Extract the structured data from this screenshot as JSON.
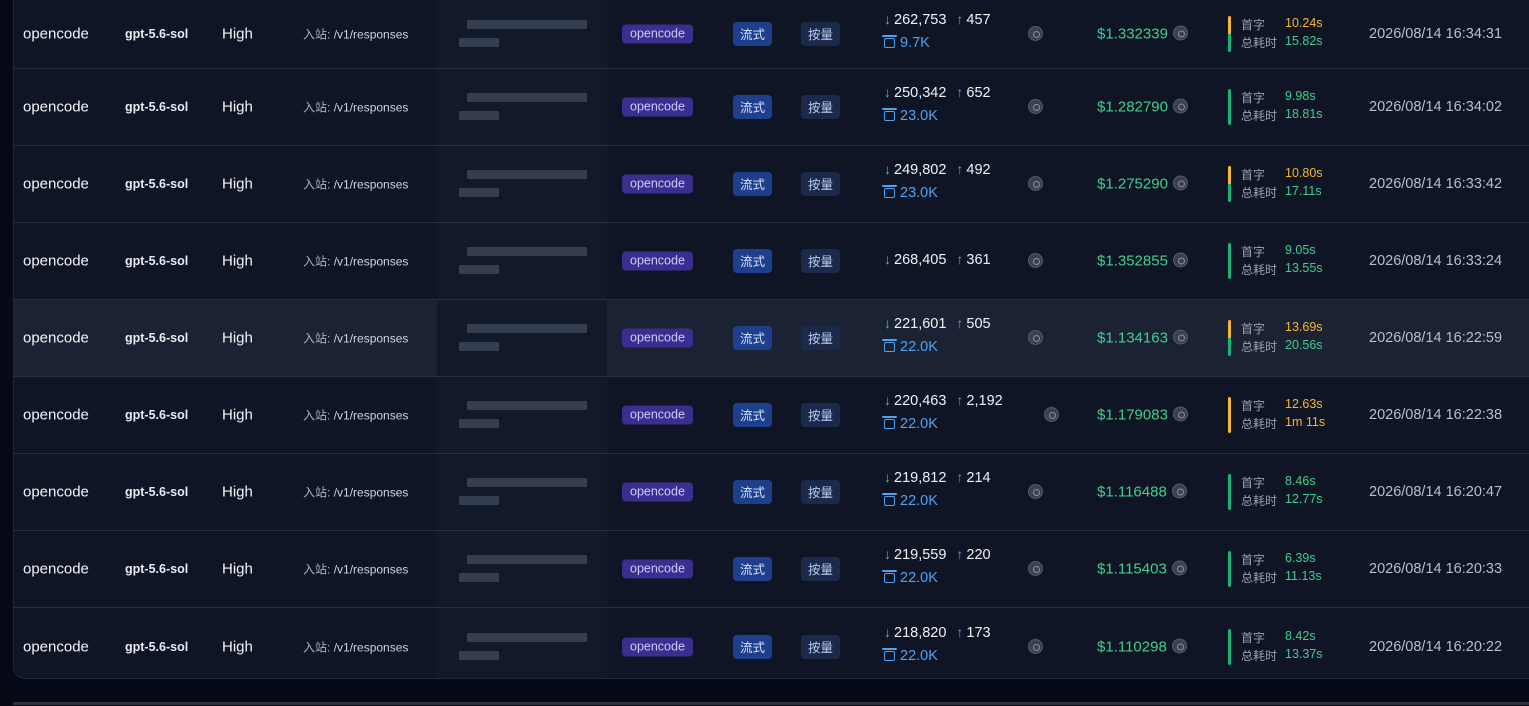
{
  "labels": {
    "endpoint_prefix": "入站:",
    "first_token": "首字",
    "total_time": "总耗时"
  },
  "colors": {
    "cost": "#3fcf8e",
    "timing_fast": "#3fcf8e",
    "timing_slow": "#f5b731",
    "bar_green": "#19b37a",
    "bar_yellow": "#f5b731"
  },
  "rows": [
    {
      "client": "opencode",
      "model": "gpt-5.6-sol",
      "effort": "High",
      "endpoint": "/v1/responses",
      "agent": "opencode",
      "mode": "流式",
      "billing": "按量",
      "input": "262,753",
      "output": "457",
      "cache": "9.7K",
      "cost": "$1.332339",
      "first_token": "10.24s",
      "first_slow": true,
      "total": "15.82s",
      "total_slow": false,
      "time": "2026/08/14 16:34:31"
    },
    {
      "client": "opencode",
      "model": "gpt-5.6-sol",
      "effort": "High",
      "endpoint": "/v1/responses",
      "agent": "opencode",
      "mode": "流式",
      "billing": "按量",
      "input": "250,342",
      "output": "652",
      "cache": "23.0K",
      "cost": "$1.282790",
      "first_token": "9.98s",
      "first_slow": false,
      "total": "18.81s",
      "total_slow": false,
      "time": "2026/08/14 16:34:02"
    },
    {
      "client": "opencode",
      "model": "gpt-5.6-sol",
      "effort": "High",
      "endpoint": "/v1/responses",
      "agent": "opencode",
      "mode": "流式",
      "billing": "按量",
      "input": "249,802",
      "output": "492",
      "cache": "23.0K",
      "cost": "$1.275290",
      "first_token": "10.80s",
      "first_slow": true,
      "total": "17.11s",
      "total_slow": false,
      "time": "2026/08/14 16:33:42"
    },
    {
      "client": "opencode",
      "model": "gpt-5.6-sol",
      "effort": "High",
      "endpoint": "/v1/responses",
      "agent": "opencode",
      "mode": "流式",
      "billing": "按量",
      "input": "268,405",
      "output": "361",
      "cache": "",
      "cost": "$1.352855",
      "first_token": "9.05s",
      "first_slow": false,
      "total": "13.55s",
      "total_slow": false,
      "time": "2026/08/14 16:33:24"
    },
    {
      "client": "opencode",
      "model": "gpt-5.6-sol",
      "effort": "High",
      "endpoint": "/v1/responses",
      "agent": "opencode",
      "mode": "流式",
      "billing": "按量",
      "input": "221,601",
      "output": "505",
      "cache": "22.0K",
      "cost": "$1.134163",
      "first_token": "13.69s",
      "first_slow": true,
      "total": "20.56s",
      "total_slow": false,
      "time": "2026/08/14 16:22:59"
    },
    {
      "client": "opencode",
      "model": "gpt-5.6-sol",
      "effort": "High",
      "endpoint": "/v1/responses",
      "agent": "opencode",
      "mode": "流式",
      "billing": "按量",
      "input": "220,463",
      "output": "2,192",
      "cache": "22.0K",
      "cost": "$1.179083",
      "first_token": "12.63s",
      "first_slow": true,
      "total": "1m 11s",
      "total_slow": true,
      "time": "2026/08/14 16:22:38"
    },
    {
      "client": "opencode",
      "model": "gpt-5.6-sol",
      "effort": "High",
      "endpoint": "/v1/responses",
      "agent": "opencode",
      "mode": "流式",
      "billing": "按量",
      "input": "219,812",
      "output": "214",
      "cache": "22.0K",
      "cost": "$1.116488",
      "first_token": "8.46s",
      "first_slow": false,
      "total": "12.77s",
      "total_slow": false,
      "time": "2026/08/14 16:20:47"
    },
    {
      "client": "opencode",
      "model": "gpt-5.6-sol",
      "effort": "High",
      "endpoint": "/v1/responses",
      "agent": "opencode",
      "mode": "流式",
      "billing": "按量",
      "input": "219,559",
      "output": "220",
      "cache": "22.0K",
      "cost": "$1.115403",
      "first_token": "6.39s",
      "first_slow": false,
      "total": "11.13s",
      "total_slow": false,
      "time": "2026/08/14 16:20:33"
    },
    {
      "client": "opencode",
      "model": "gpt-5.6-sol",
      "effort": "High",
      "endpoint": "/v1/responses",
      "agent": "opencode",
      "mode": "流式",
      "billing": "按量",
      "input": "218,820",
      "output": "173",
      "cache": "22.0K",
      "cost": "$1.110298",
      "first_token": "8.42s",
      "first_slow": false,
      "total": "13.37s",
      "total_slow": false,
      "time": "2026/08/14 16:20:22"
    }
  ]
}
